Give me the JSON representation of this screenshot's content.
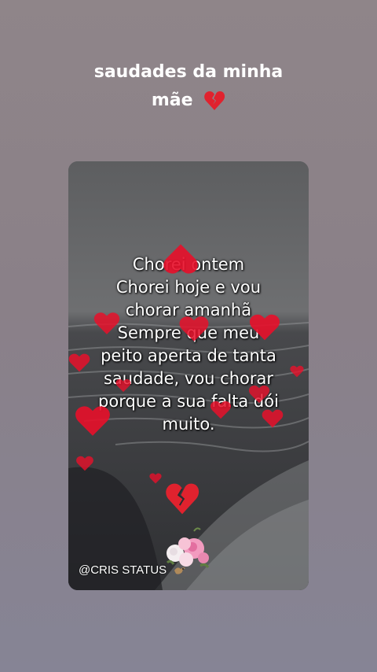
{
  "caption": {
    "line1": "saudades da minha",
    "line2": "mãe",
    "emoji": "broken-heart-icon"
  },
  "card": {
    "poem_lines": [
      "Chorei ontem",
      "Chorei hoje e vou",
      "chorar amanhã",
      "Sempre que meu",
      "peito aperta de tanta",
      "saudade, vou chorar",
      "porque a sua falta dói",
      "muito."
    ],
    "watermark": "@CRIS STATUS",
    "decor": [
      "heart-icon",
      "broken-heart-icon",
      "flower-bouquet-icon",
      "bird-icon"
    ]
  },
  "colors": {
    "background": "#8a8088",
    "heart": "#e8102a",
    "text": "#ffffff"
  }
}
